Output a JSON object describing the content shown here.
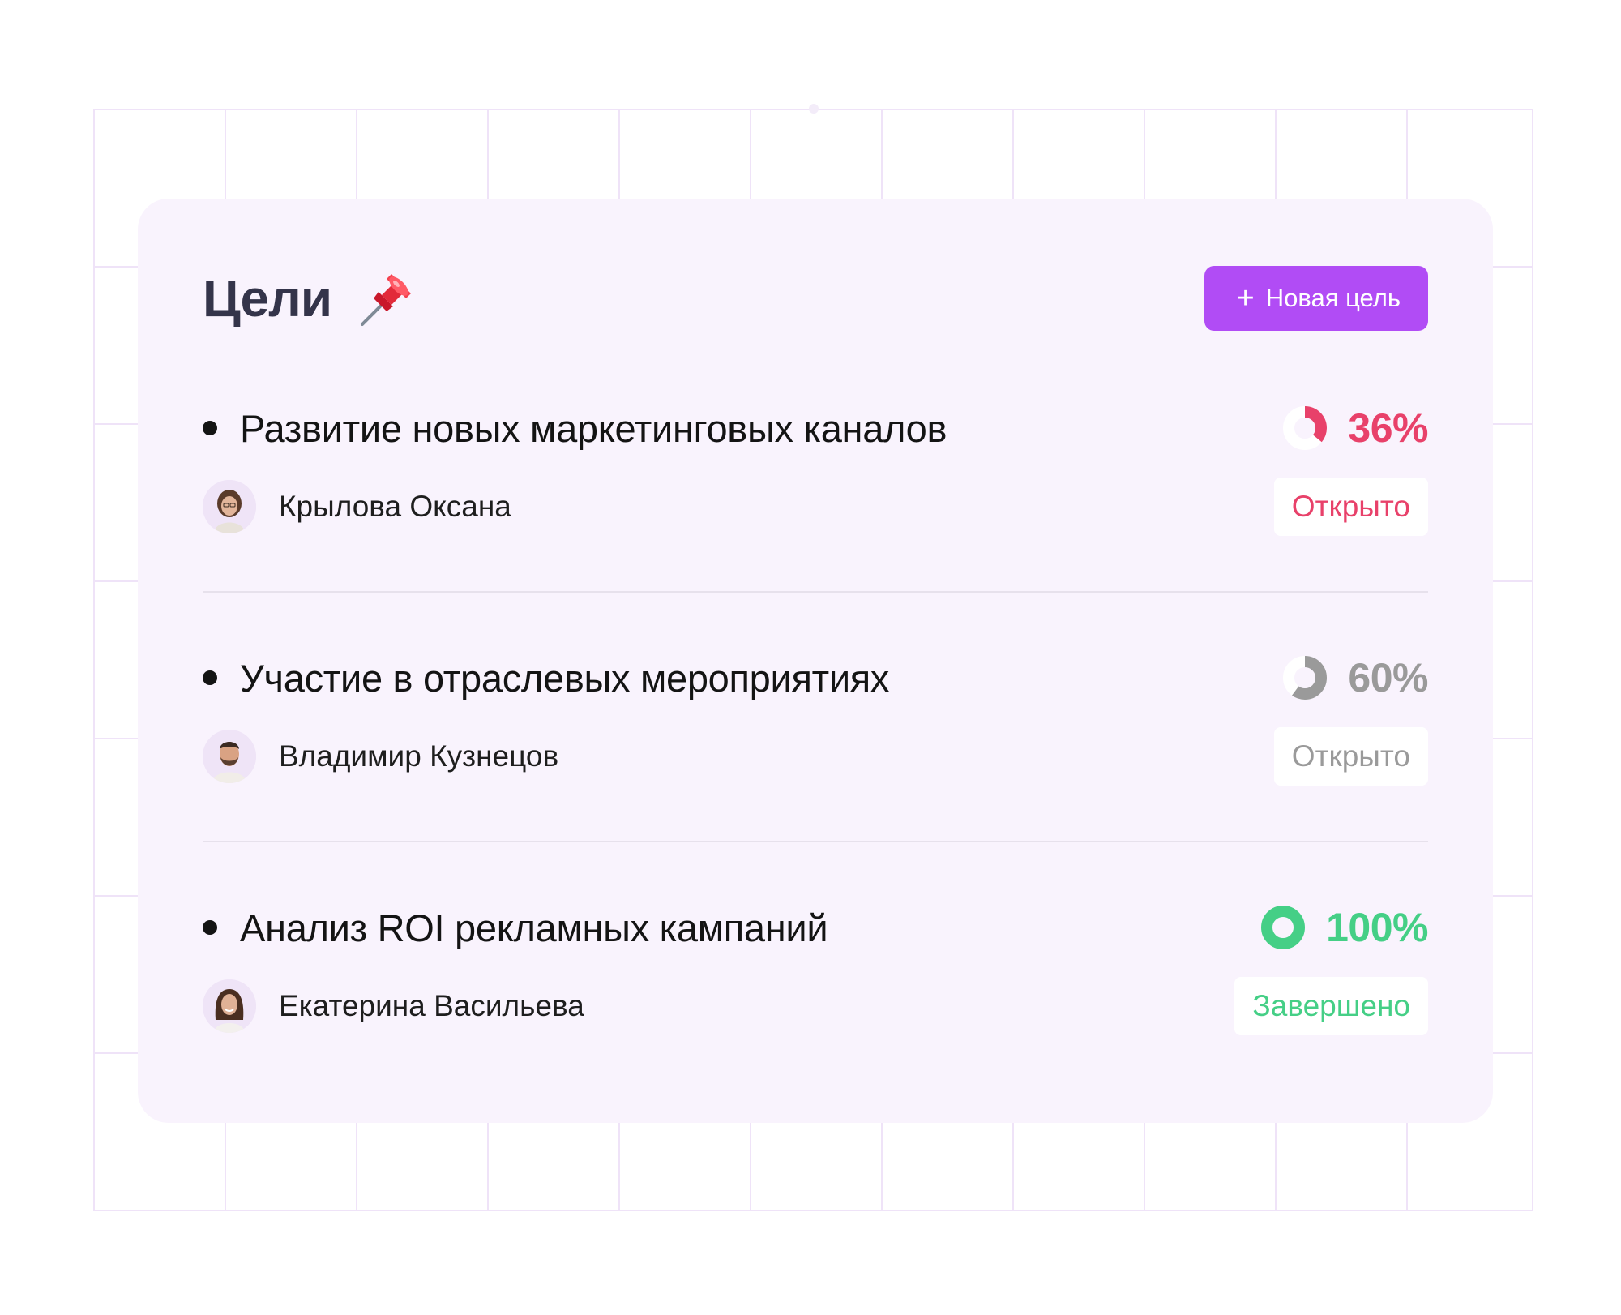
{
  "header": {
    "title": "Цели",
    "pin_icon": "pushpin-icon",
    "new_goal_label": "Новая цель",
    "button_color": "#b14cf5"
  },
  "goals": [
    {
      "title": "Развитие новых маркетинговых каналов",
      "progress": 36,
      "progress_label": "36%",
      "progress_color": "#e8416a",
      "owner": "Крылова Оксана",
      "status": "Открыто",
      "status_color": "#e8416a"
    },
    {
      "title": "Участие в отраслевых мероприятиях",
      "progress": 60,
      "progress_label": "60%",
      "progress_color": "#9a9a9a",
      "owner": "Владимир Кузнецов",
      "status": "Открыто",
      "status_color": "#9a9a9a"
    },
    {
      "title": "Анализ ROI рекламных кампаний",
      "progress": 100,
      "progress_label": "100%",
      "progress_color": "#45cf86",
      "owner": "Екатерина Васильева",
      "status": "Завершено",
      "status_color": "#45cf86"
    }
  ]
}
